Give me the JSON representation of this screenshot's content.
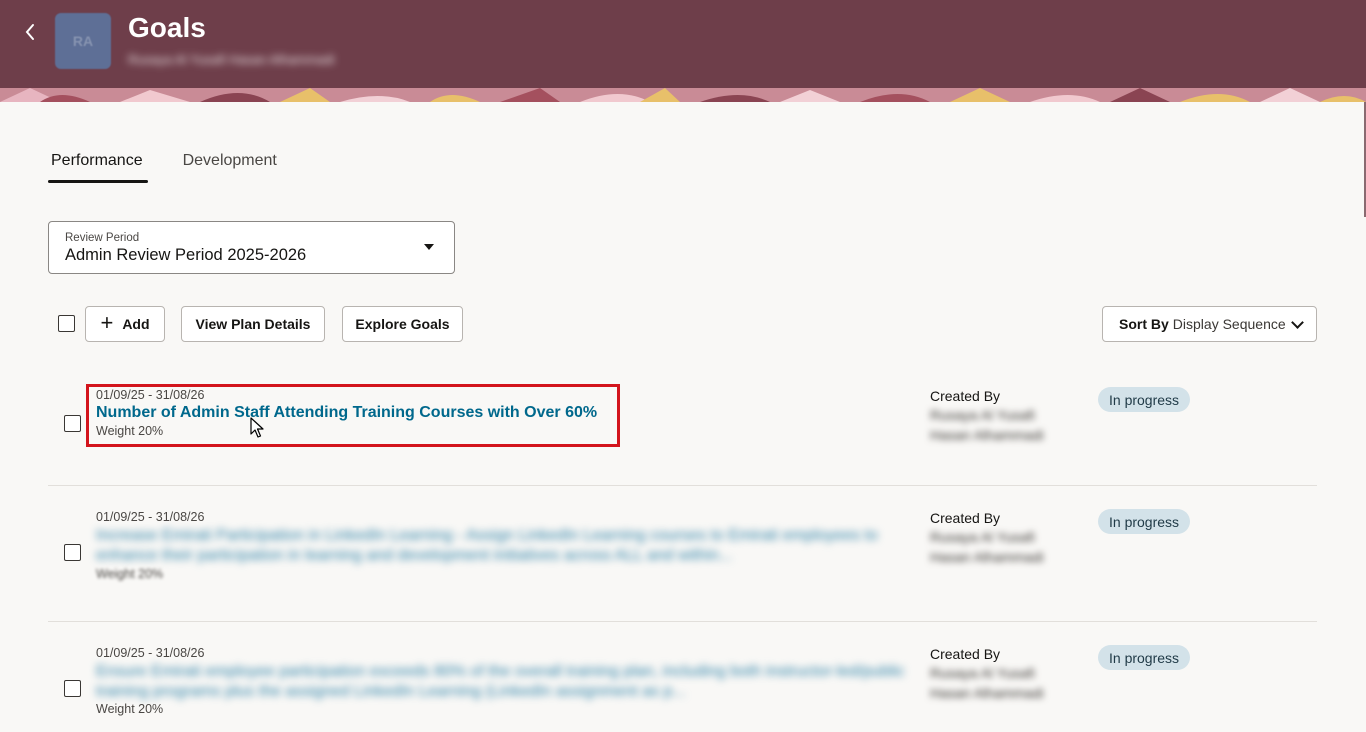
{
  "header": {
    "title": "Goals",
    "subtitle": "Rusaya Al Yusafi Hasan Alhammadi",
    "avatar_initials": "RA",
    "back_icon": "chevron-left-icon"
  },
  "tabs": [
    {
      "label": "Performance",
      "active": true
    },
    {
      "label": "Development",
      "active": false
    }
  ],
  "review_period": {
    "label": "Review Period",
    "value": "Admin Review Period 2025-2026"
  },
  "toolbar": {
    "add_label": "Add",
    "view_plan_label": "View Plan Details",
    "explore_label": "Explore Goals",
    "sort_label": "Sort By",
    "sort_value": "Display Sequence"
  },
  "goals": [
    {
      "dates": "01/09/25 - 31/08/26",
      "title": "Number of Admin Staff Attending Training Courses with Over 60%",
      "weight": "Weight 20%",
      "created_by_label": "Created By",
      "created_by": "Rusaya Al Yusafi Hasan Alhammadi",
      "status": "In progress"
    },
    {
      "dates": "01/09/25 - 31/08/26",
      "title": "Increase Emirati Participation in LinkedIn Learning - Assign LinkedIn Learning courses to Emirati employees to enhance their participation in learning and development initiatives across ALL and within...",
      "weight": "Weight 20%",
      "created_by_label": "Created By",
      "created_by": "Rusaya Al Yusafi Hasan Alhammadi",
      "status": "In progress"
    },
    {
      "dates": "01/09/25 - 31/08/26",
      "title": "Ensure Emirati employee participation exceeds 80% of the overall training plan, including both instructor-led/public training programs plus the assigned LinkedIn Learning (LinkedIn assignment as p...",
      "weight": "Weight 20%",
      "created_by_label": "Created By",
      "created_by": "Rusaya Al Yusafi Hasan Alhammadi",
      "status": "In progress"
    }
  ],
  "colors": {
    "header_bg": "#6e3e4a",
    "link": "#00688c",
    "badge_bg": "#d3e2e9",
    "highlight": "#d3141c"
  }
}
